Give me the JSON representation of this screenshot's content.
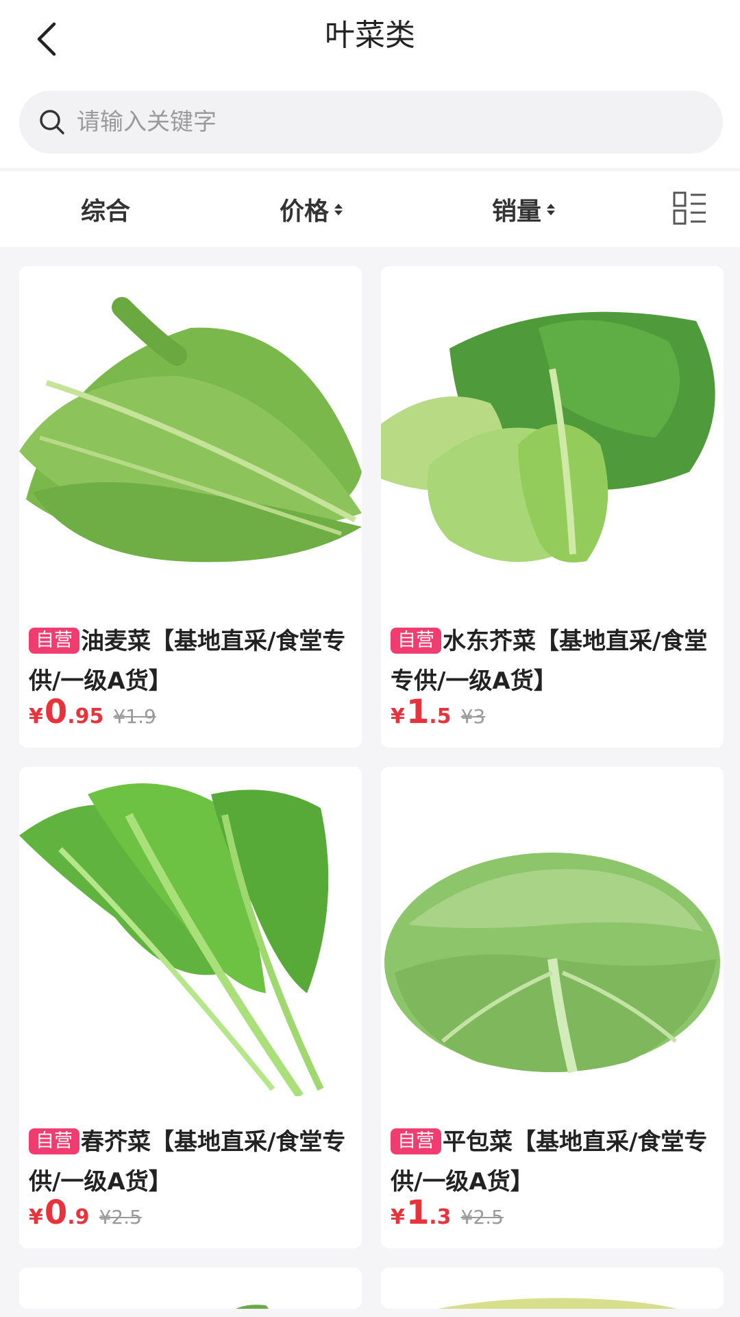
{
  "header": {
    "title": "叶菜类",
    "back_icon": "chevron-left-icon"
  },
  "search": {
    "placeholder": "请输入关键字",
    "icon": "search-icon"
  },
  "sort": {
    "items": [
      {
        "label": "综合"
      },
      {
        "label": "价格"
      },
      {
        "label": "销量"
      }
    ],
    "layout_icon": "list-layout-icon"
  },
  "colors": {
    "accent": "#e8323c",
    "badge": "#f03c6e",
    "background": "#f5f5f7"
  },
  "products": [
    {
      "badge": "自营",
      "name": "油麦菜【基地直采/食堂专供/一级A货】",
      "currency": "¥",
      "price_int": "0",
      "price_dec": ".95",
      "price_old": "¥1.9",
      "image": "romaine-lettuce-image"
    },
    {
      "badge": "自营",
      "name": "水东芥菜【基地直采/食堂专供/一级A货】",
      "currency": "¥",
      "price_int": "1",
      "price_dec": ".5",
      "price_old": "¥3",
      "image": "mustard-greens-image"
    },
    {
      "badge": "自营",
      "name": "春芥菜【基地直采/食堂专供/一级A货】",
      "currency": "¥",
      "price_int": "0",
      "price_dec": ".9",
      "price_old": "¥2.5",
      "image": "spring-mustard-image"
    },
    {
      "badge": "自营",
      "name": "平包菜【基地直采/食堂专供/一级A货】",
      "currency": "¥",
      "price_int": "1",
      "price_dec": ".3",
      "price_old": "¥2.5",
      "image": "cabbage-image"
    }
  ]
}
